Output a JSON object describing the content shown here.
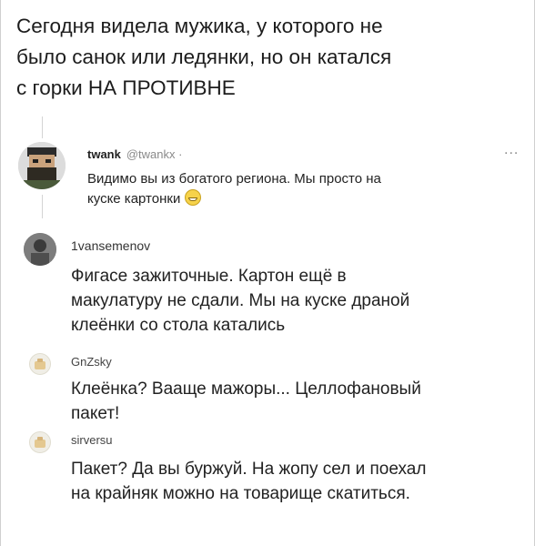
{
  "post": {
    "lines": [
      "Сегодня видела мужика, у которого не",
      "было санок или ледянки, но он катался",
      "с горки НА ПРОТИВНЕ"
    ]
  },
  "tweet": {
    "name": "twank",
    "handle": "@twankx ·",
    "more": "...",
    "text_lines": [
      "Видимо вы из богатого региона. Мы просто на",
      "куске картонки"
    ],
    "emoji": "grinning-face-with-smiling-eyes"
  },
  "comments": [
    {
      "user": "1vansemenov",
      "lines": [
        "Фигасе зажиточные. Картон ещё в",
        "макулатуру не сдали. Мы на куске драной",
        "клеёнки со стола катались"
      ]
    },
    {
      "user": "GnZsky",
      "lines": [
        "Клеёнка? Вааще мажоры...  Целлофановый",
        "пакет!"
      ]
    },
    {
      "user": "sirversu",
      "lines": [
        "Пакет? Да вы буржуй. На жопу сел и поехал",
        "на крайняк можно на товарище скатиться."
      ]
    }
  ]
}
